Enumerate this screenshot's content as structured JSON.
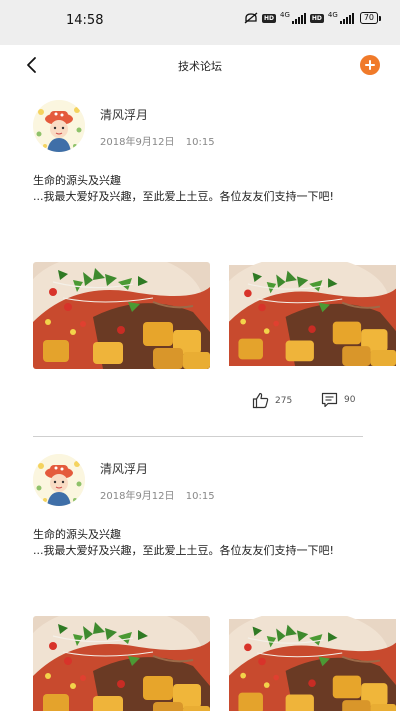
{
  "status_bar": {
    "time": "14:58",
    "battery": "70",
    "network_1": "4G",
    "network_2": "4G",
    "hd": "HD"
  },
  "nav": {
    "title": "技术论坛"
  },
  "posts": [
    {
      "author": "清风浮月",
      "date": "2018年9月12日",
      "time": "10:15",
      "title": "生命的源头及兴趣",
      "body": "...我最大爱好及兴趣，至此爱上土豆。各位友友们支持一下吧!",
      "likes": "275",
      "comments": "90"
    },
    {
      "author": "清风浮月",
      "date": "2018年9月12日",
      "time": "10:15",
      "title": "生命的源头及兴趣",
      "body": "...我最大爱好及兴趣，至此爱上土豆。各位友友们支持一下吧!"
    }
  ],
  "colors": {
    "accent": "#f07a2a",
    "status_bg": "#eeeeee",
    "divider": "#cfcfcf"
  }
}
